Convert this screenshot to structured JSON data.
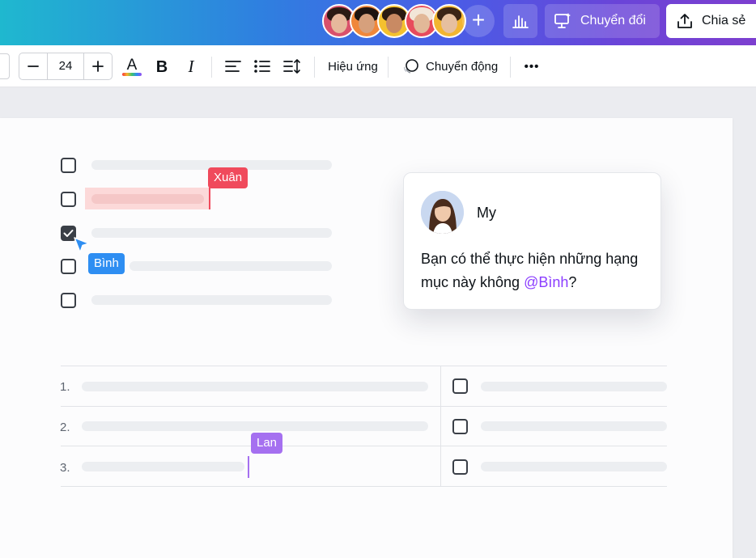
{
  "topbar": {
    "collaborators": [
      {
        "name": "collab-1",
        "bg": "#d9516b",
        "hair": "#2b1b14",
        "skin": "#e6b89c"
      },
      {
        "name": "collab-2",
        "bg": "#f0873a",
        "hair": "#1e1410",
        "skin": "#d6a07c"
      },
      {
        "name": "collab-3",
        "bg": "#f4c12f",
        "hair": "#2a1a12",
        "skin": "#c98a63"
      },
      {
        "name": "collab-4",
        "bg": "#e84b5c",
        "hair": "#f2e6d8",
        "skin": "#e2b898"
      },
      {
        "name": "collab-5",
        "bg": "#f2b531",
        "hair": "#3b2416",
        "skin": "#e6bf9f"
      }
    ],
    "present_label": "Chuyển đổi",
    "share_label": "Chia sẻ"
  },
  "toolbar": {
    "font_size": "24",
    "effects_label": "Hiệu ứng",
    "animate_label": "Chuyển động",
    "more_label": "•••"
  },
  "canvas": {
    "cursors": {
      "xuan": {
        "label": "Xuân",
        "color": "#f04a5c"
      },
      "binh": {
        "label": "Bình",
        "color": "#2e8ef2"
      },
      "lan": {
        "label": "Lan",
        "color": "#a570f0"
      }
    },
    "comment": {
      "author": "My",
      "text_before": "Bạn có thể thực hiện những hạng mục này không ",
      "mention": "@Bình",
      "text_after": "?"
    },
    "numbered_rows": [
      "1.",
      "2.",
      "3."
    ]
  }
}
